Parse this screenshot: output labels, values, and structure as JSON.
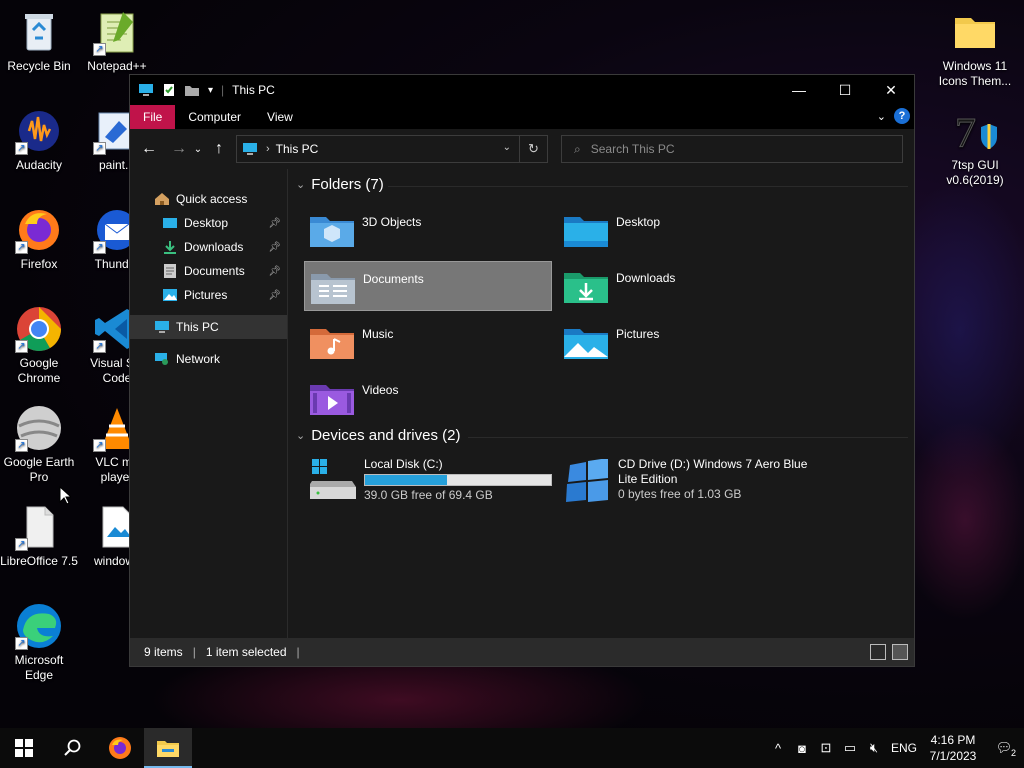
{
  "desktop": {
    "icons_left": [
      {
        "label": "Recycle Bin",
        "icon": "recycle-bin-icon"
      },
      {
        "label": "Audacity",
        "icon": "audacity-icon"
      },
      {
        "label": "Firefox",
        "icon": "firefox-icon"
      },
      {
        "label": "Google Chrome",
        "icon": "chrome-icon"
      },
      {
        "label": "Google Earth Pro",
        "icon": "google-earth-icon"
      },
      {
        "label": "LibreOffice 7.5",
        "icon": "libreoffice-icon"
      },
      {
        "label": "Microsoft Edge",
        "icon": "edge-icon"
      }
    ],
    "icons_col2": [
      {
        "label": "Notepad++",
        "icon": "notepadpp-icon"
      },
      {
        "label": "paint.n",
        "icon": "paintnet-icon"
      },
      {
        "label": "Thunder",
        "icon": "thunderbird-icon"
      },
      {
        "label": "Visual Stu Code",
        "icon": "vscode-icon"
      },
      {
        "label": "VLC me player",
        "icon": "vlc-icon"
      },
      {
        "label": "windows",
        "icon": "image-file-icon"
      }
    ],
    "icons_right": [
      {
        "label": "Windows 11 Icons Them...",
        "icon": "folder-icon"
      },
      {
        "label": "7tsp GUI v0.6(2019)",
        "icon": "7tsp-icon"
      }
    ]
  },
  "window": {
    "title": "This PC",
    "ribbon_tabs": [
      "File",
      "Computer",
      "View"
    ],
    "address": {
      "location": "This PC"
    },
    "search": {
      "placeholder": "Search This PC"
    },
    "nav_pane": {
      "quick_access": "Quick access",
      "quick_items": [
        "Desktop",
        "Downloads",
        "Documents",
        "Pictures"
      ],
      "this_pc": "This PC",
      "network": "Network"
    },
    "folders_header": "Folders (7)",
    "folders": [
      "3D Objects",
      "Desktop",
      "Documents",
      "Downloads",
      "Music",
      "Pictures",
      "Videos"
    ],
    "selected_folder": "Documents",
    "drives_header": "Devices and drives (2)",
    "drives": [
      {
        "name": "Local Disk (C:)",
        "free": "39.0 GB free of 69.4 GB",
        "used_fraction": 0.44
      },
      {
        "name": "CD Drive (D:) Windows 7 Aero Blue Lite Edition",
        "free": "0 bytes free of 1.03 GB"
      }
    ],
    "status": {
      "items": "9 items",
      "selected": "1 item selected"
    }
  },
  "taskbar": {
    "language": "ENG",
    "time": "4:16 PM",
    "date": "7/1/2023",
    "notification_count": "2"
  },
  "colors": {
    "accent": "#c0134a",
    "progress": "#26a0da",
    "selection": "#777777"
  }
}
